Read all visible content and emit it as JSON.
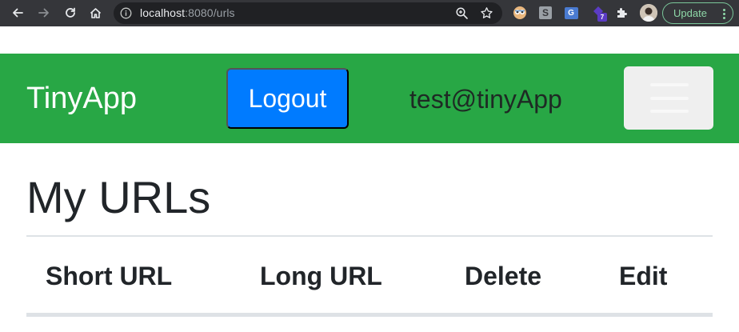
{
  "browser": {
    "url_host": "localhost",
    "url_rest": ":8080/urls",
    "update_label": "Update",
    "extensions": {
      "s_label": "S",
      "translate_label": "G",
      "badge_count": "7"
    }
  },
  "navbar": {
    "brand": "TinyApp",
    "logout_label": "Logout",
    "user_email": "test@tinyApp",
    "color": "#28a745",
    "logout_color": "#007bff"
  },
  "main": {
    "title": "My URLs",
    "table": {
      "columns": [
        "Short URL",
        "Long URL",
        "Delete",
        "Edit"
      ],
      "rows": []
    }
  },
  "icons": {
    "back": "arrow-left-icon",
    "forward": "arrow-right-icon",
    "reload": "reload-icon",
    "home": "home-icon",
    "info": "info-icon",
    "zoom": "zoom-icon",
    "star": "star-icon",
    "puzzle": "extensions-icon",
    "menu": "hamburger-icon"
  }
}
